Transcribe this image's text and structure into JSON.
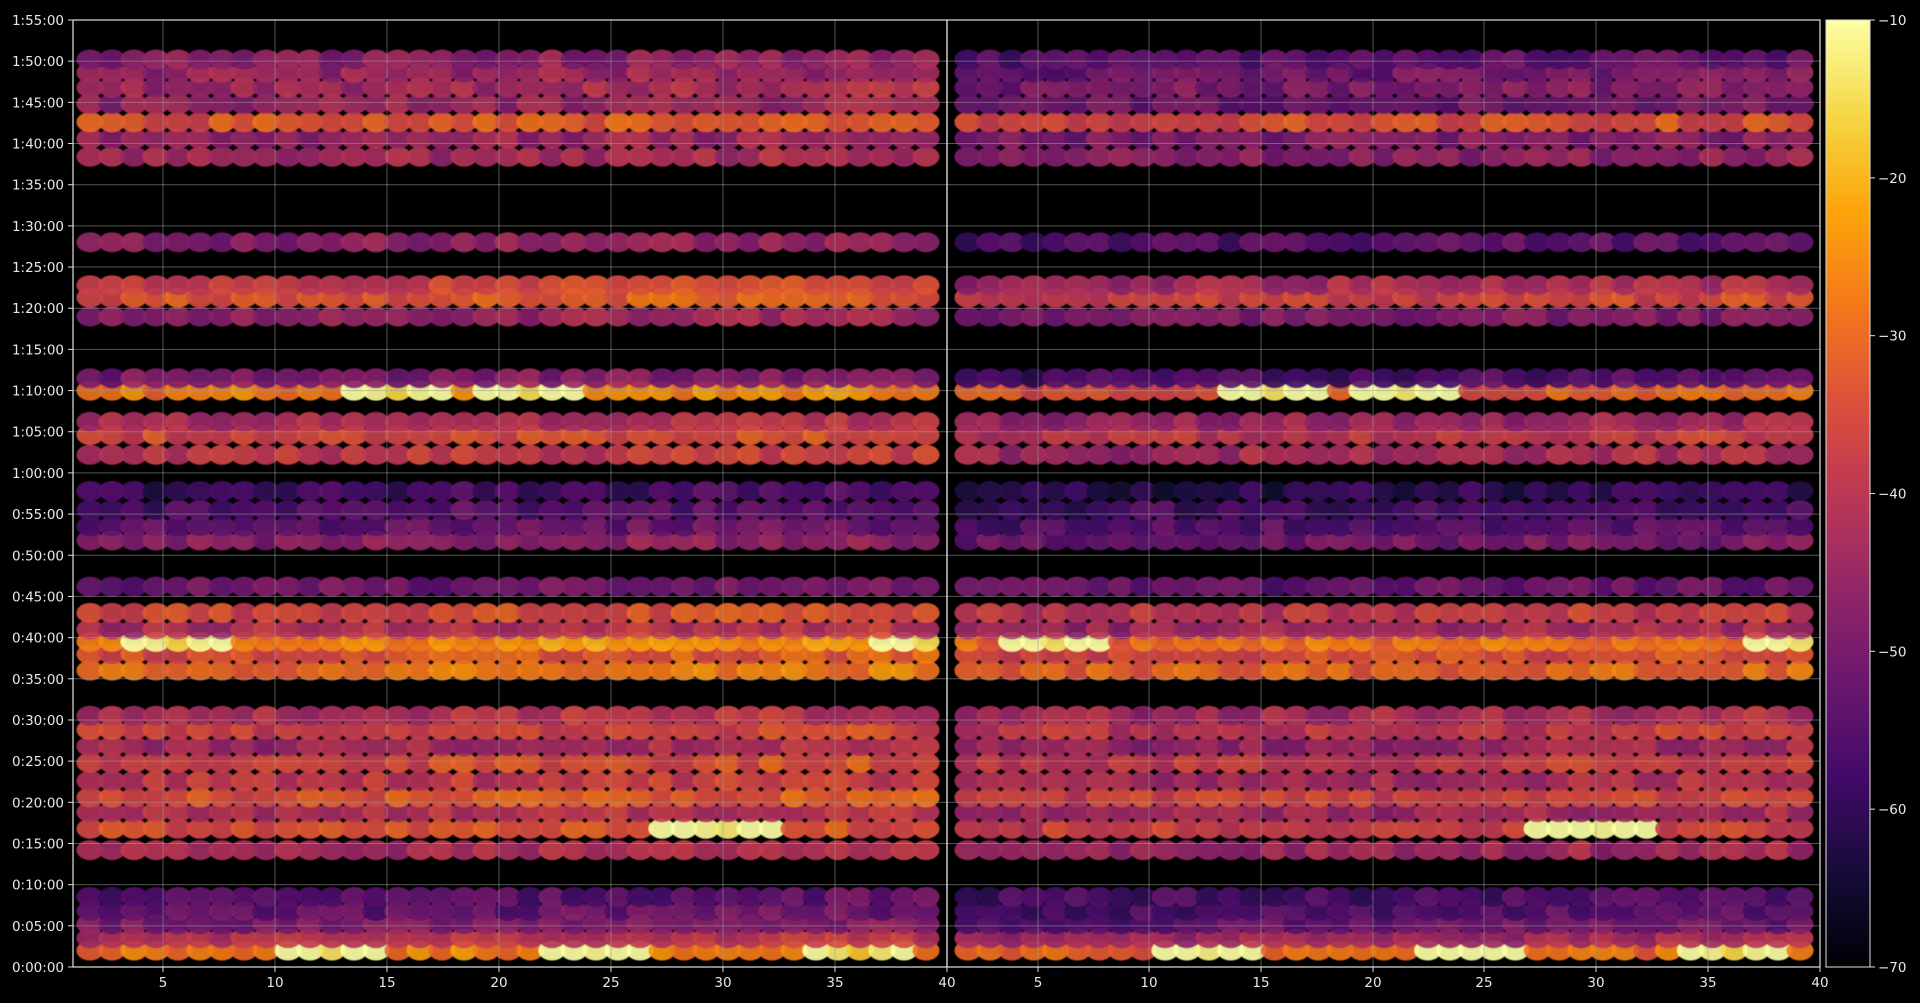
{
  "chart_data": {
    "type": "heatmap",
    "title": "",
    "xlabel": "",
    "ylabel": "",
    "panels": [
      {
        "name": "",
        "xlim": [
          1,
          40
        ],
        "x_ticks": [
          5,
          10,
          15,
          20,
          25,
          30,
          35,
          40
        ]
      },
      {
        "name": "",
        "xlim": [
          1,
          40
        ],
        "x_ticks": [
          5,
          10,
          15,
          20,
          25,
          30,
          35,
          40
        ]
      }
    ],
    "y_ticks": [
      "0:00:00",
      "0:05:00",
      "0:10:00",
      "0:15:00",
      "0:20:00",
      "0:25:00",
      "0:30:00",
      "0:35:00",
      "0:40:00",
      "0:45:00",
      "0:50:00",
      "0:55:00",
      "1:00:00",
      "1:05:00",
      "1:10:00",
      "1:15:00",
      "1:20:00",
      "1:25:00",
      "1:30:00",
      "1:35:00",
      "1:40:00",
      "1:45:00",
      "1:50:00",
      "1:55:00"
    ],
    "ylim_minutes": [
      0,
      115
    ],
    "colorbar": {
      "min": -70,
      "max": -10,
      "ticks": [
        "-10",
        "-20",
        "-30",
        "-40",
        "-50",
        "-60",
        "-70"
      ],
      "colormap": "inferno"
    },
    "grid": true,
    "columns_per_panel": 39,
    "rows": [
      {
        "minute": 2.0,
        "panel1": -28,
        "panel2": -32,
        "hot_spots": [
          {
            "x": 12,
            "v": -14
          },
          {
            "x": 24,
            "v": -11
          },
          {
            "x": 36,
            "v": -18
          }
        ]
      },
      {
        "minute": 3.5,
        "panel1": -42,
        "panel2": -46
      },
      {
        "minute": 5.2,
        "panel1": -50,
        "panel2": -54
      },
      {
        "minute": 6.8,
        "panel1": -54,
        "panel2": -57
      },
      {
        "minute": 8.5,
        "panel1": -56,
        "panel2": -58
      },
      {
        "minute": 14.2,
        "panel1": -44,
        "panel2": -46
      },
      {
        "minute": 16.8,
        "panel1": -36,
        "panel2": -38,
        "hot_spots": [
          {
            "x": 29,
            "v": -18
          },
          {
            "x": 30,
            "v": -16
          }
        ]
      },
      {
        "minute": 18.8,
        "panel1": -42,
        "panel2": -45
      },
      {
        "minute": 20.6,
        "panel1": -34,
        "panel2": -38
      },
      {
        "minute": 22.6,
        "panel1": -40,
        "panel2": -44
      },
      {
        "minute": 24.8,
        "panel1": -36,
        "panel2": -40
      },
      {
        "minute": 26.8,
        "panel1": -44,
        "panel2": -46
      },
      {
        "minute": 28.8,
        "panel1": -38,
        "panel2": -40
      },
      {
        "minute": 30.5,
        "panel1": -42,
        "panel2": -44
      },
      {
        "minute": 36.0,
        "panel1": -30,
        "panel2": -32
      },
      {
        "minute": 38.0,
        "panel1": -34,
        "panel2": -36
      },
      {
        "minute": 39.5,
        "panel1": -26,
        "panel2": -30,
        "hot_spots": [
          {
            "x": 5,
            "v": -16
          },
          {
            "x": 39,
            "v": -15
          }
        ]
      },
      {
        "minute": 41.0,
        "panel1": -42,
        "panel2": -45
      },
      {
        "minute": 43.0,
        "panel1": -36,
        "panel2": -40
      },
      {
        "minute": 46.2,
        "panel1": -52,
        "panel2": -54
      },
      {
        "minute": 51.8,
        "panel1": -48,
        "panel2": -52
      },
      {
        "minute": 53.5,
        "panel1": -54,
        "panel2": -56
      },
      {
        "minute": 55.5,
        "panel1": -56,
        "panel2": -58
      },
      {
        "minute": 57.8,
        "panel1": -59,
        "panel2": -62
      },
      {
        "minute": 62.2,
        "panel1": -40,
        "panel2": -44
      },
      {
        "minute": 64.6,
        "panel1": -36,
        "panel2": -40
      },
      {
        "minute": 66.2,
        "panel1": -42,
        "panel2": -46
      },
      {
        "minute": 70.0,
        "panel1": -28,
        "panel2": -34,
        "hot_spots": [
          {
            "x": 15,
            "v": -16
          },
          {
            "x": 21,
            "v": -15
          }
        ]
      },
      {
        "minute": 71.5,
        "panel1": -50,
        "panel2": -58
      },
      {
        "minute": 79.0,
        "panel1": -46,
        "panel2": -50
      },
      {
        "minute": 81.3,
        "panel1": -34,
        "panel2": -38
      },
      {
        "minute": 82.8,
        "panel1": -38,
        "panel2": -44
      },
      {
        "minute": 88.0,
        "panel1": -48,
        "panel2": -56
      },
      {
        "minute": 98.4,
        "panel1": -44,
        "panel2": -48
      },
      {
        "minute": 100.6,
        "panel1": -46,
        "panel2": -50
      },
      {
        "minute": 102.6,
        "panel1": -34,
        "panel2": -36
      },
      {
        "minute": 104.8,
        "panel1": -46,
        "panel2": -52
      },
      {
        "minute": 106.8,
        "panel1": -44,
        "panel2": -50
      },
      {
        "minute": 108.6,
        "panel1": -46,
        "panel2": -52
      },
      {
        "minute": 110.2,
        "panel1": -48,
        "panel2": -56
      }
    ]
  }
}
